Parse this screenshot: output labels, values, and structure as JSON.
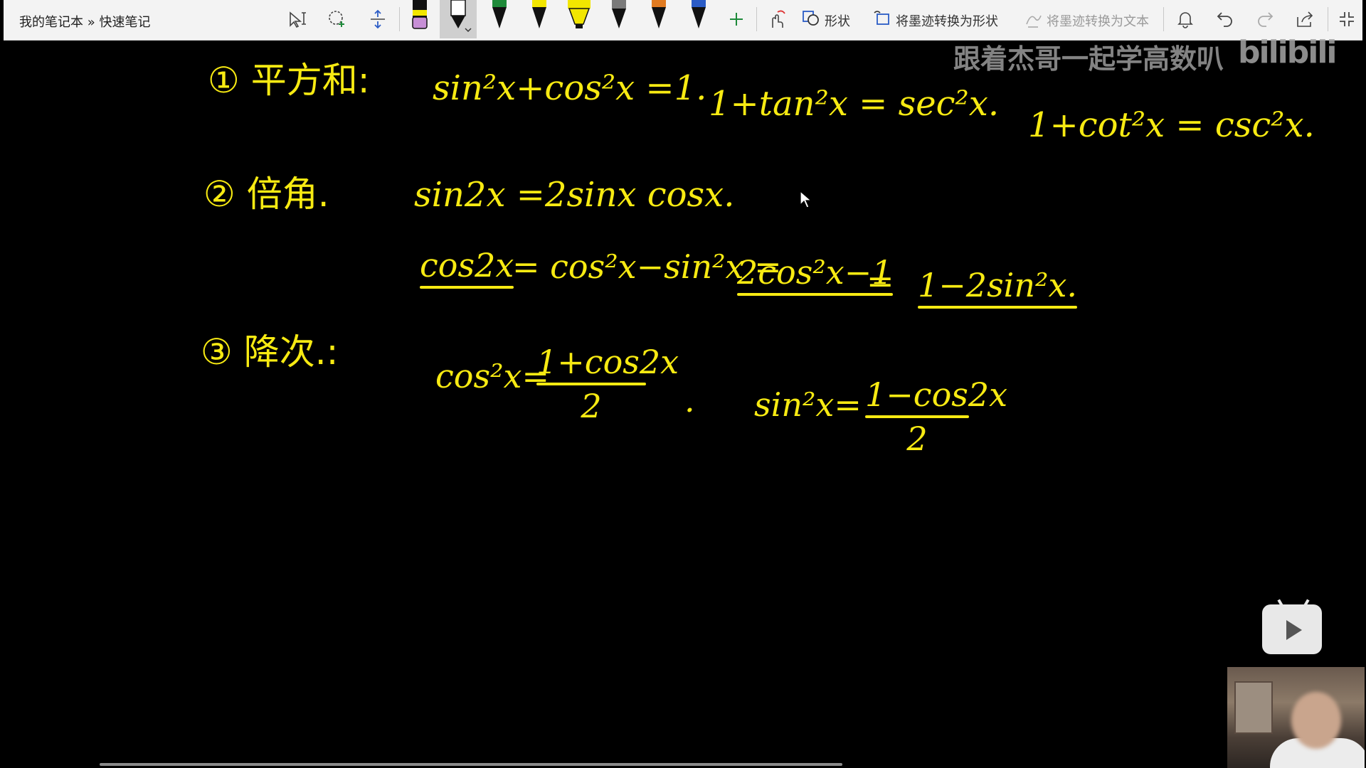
{
  "toolbar": {
    "breadcrumb": "我的笔记本 » 快速笔记",
    "tools": [
      {
        "name": "text-select",
        "icon": "select-text-icon"
      },
      {
        "name": "lasso",
        "icon": "lasso-add-icon"
      },
      {
        "name": "space",
        "icon": "add-space-icon"
      }
    ],
    "pens": [
      {
        "icon": "pen-icon",
        "color": "#c78fd6"
      },
      {
        "icon": "pen-icon",
        "color": "#ffffff",
        "selected": true
      },
      {
        "icon": "pen-icon",
        "color": "#1f8a3a"
      },
      {
        "icon": "pen-icon",
        "color": "#f2e600"
      },
      {
        "icon": "highlighter-icon",
        "color": "#f2e600"
      },
      {
        "icon": "pencil-icon",
        "color": "#7a7a7a"
      },
      {
        "icon": "pen-icon",
        "color": "#e07b22"
      },
      {
        "icon": "pen-icon",
        "color": "#2b5cc6"
      }
    ],
    "commands": {
      "shapes_label": "形状",
      "ink_to_shape_label": "将墨迹转换为形状",
      "ink_to_text_label": "将墨迹转换为文本"
    }
  },
  "watermark": {
    "text": "跟着杰哥一起学高数叭",
    "logo": "bilibili"
  },
  "notes": {
    "item1": {
      "label": "① 平方和:",
      "eq1": "sin²x+cos²x =1.",
      "eq2": "1+tan²x = sec²x.",
      "eq3": "1+cot²x = csc²x."
    },
    "item2": {
      "label": "② 倍角.",
      "eq1": "sin2x =2sinx cosx.",
      "cos2x": "cos2x",
      "cos2x_eq": "= cos²x−sin²x =",
      "form2": "2cos²x−1",
      "eq_sign": "=",
      "form3": "1−2sin²x."
    },
    "item3": {
      "label": "③ 降次.:",
      "cos_lhs": "cos²x=",
      "cos_num": "1+cos2x",
      "cos_den": "2",
      "dot": ".",
      "sin_lhs": "sin²x=",
      "sin_num": "1−cos2x",
      "sin_den": "2"
    }
  }
}
